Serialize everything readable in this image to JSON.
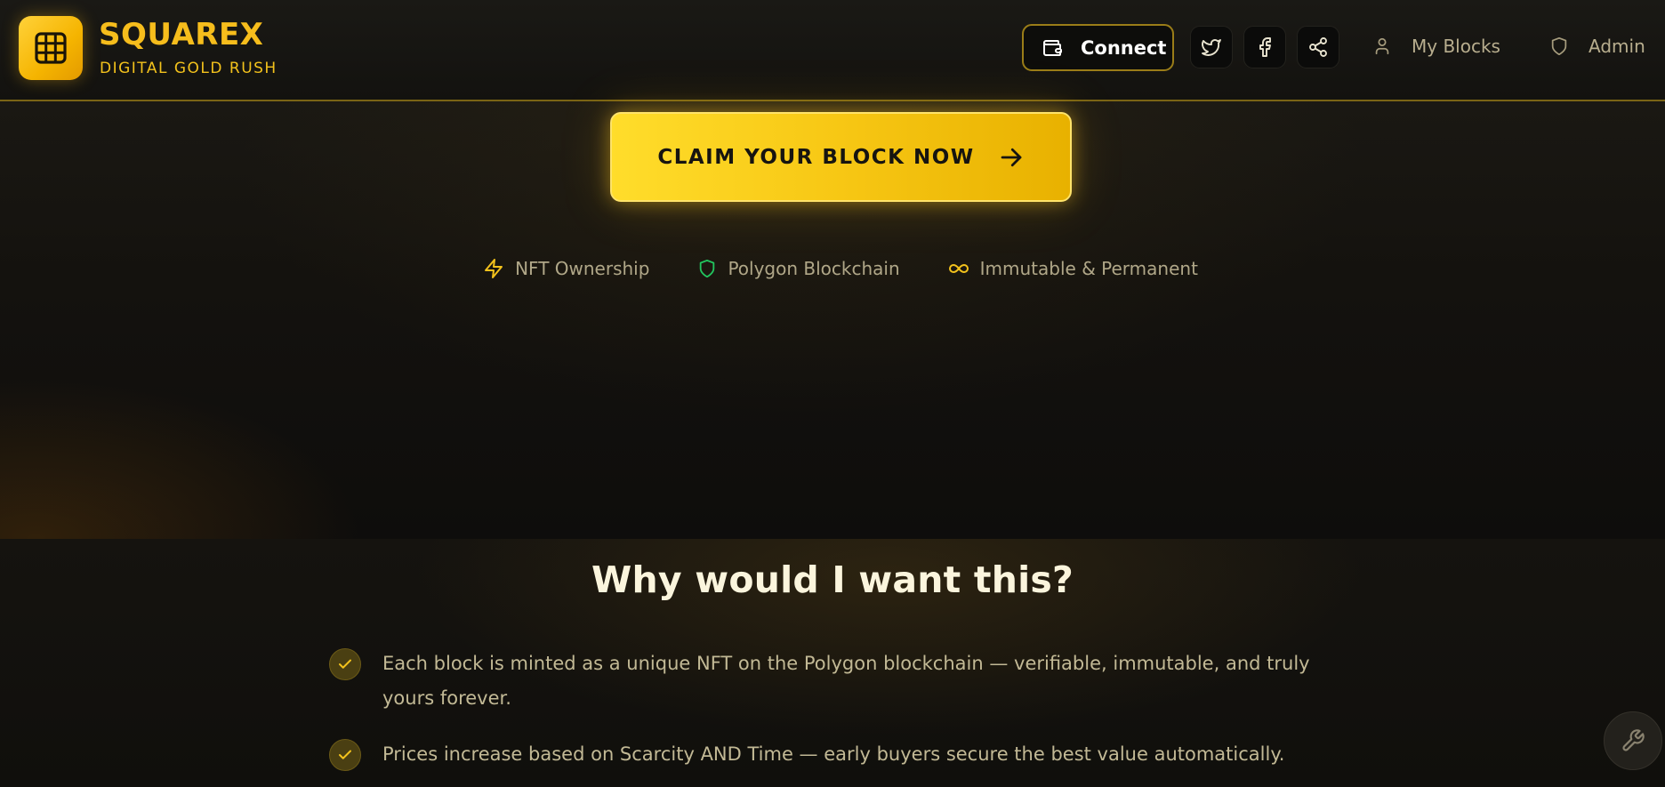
{
  "brand": {
    "title": "SQUAREX",
    "subtitle": "DIGITAL GOLD RUSH",
    "icon": "grid-icon",
    "accent_color": "#f6bd1c"
  },
  "header": {
    "connect_label": "Connect",
    "connect_icon": "wallet-icon",
    "social": [
      {
        "icon": "twitter-icon"
      },
      {
        "icon": "facebook-icon"
      },
      {
        "icon": "share-icon"
      }
    ],
    "nav": [
      {
        "label": "My Blocks",
        "icon": "user-icon"
      },
      {
        "label": "Admin",
        "icon": "shield-icon"
      }
    ]
  },
  "hero": {
    "cta_label": "CLAIM YOUR BLOCK NOW",
    "cta_icon": "arrow-right-icon",
    "features": [
      {
        "label": "NFT Ownership",
        "icon": "lightning-icon",
        "color": "#f3c21c"
      },
      {
        "label": "Polygon Blockchain",
        "icon": "shield-icon",
        "color": "#22c55e"
      },
      {
        "label": "Immutable & Permanent",
        "icon": "infinity-icon",
        "color": "#f3c21c"
      }
    ]
  },
  "why": {
    "title": "Why would I want this?",
    "items": [
      {
        "text": "Each block is minted as a unique NFT on the Polygon blockchain — verifiable, immutable, and truly yours forever.",
        "icon": "check-icon"
      },
      {
        "text": "Prices increase based on Scarcity AND Time — early buyers secure the best value automatically.",
        "icon": "check-icon"
      }
    ]
  },
  "floating": {
    "icon": "wrench-icon"
  }
}
